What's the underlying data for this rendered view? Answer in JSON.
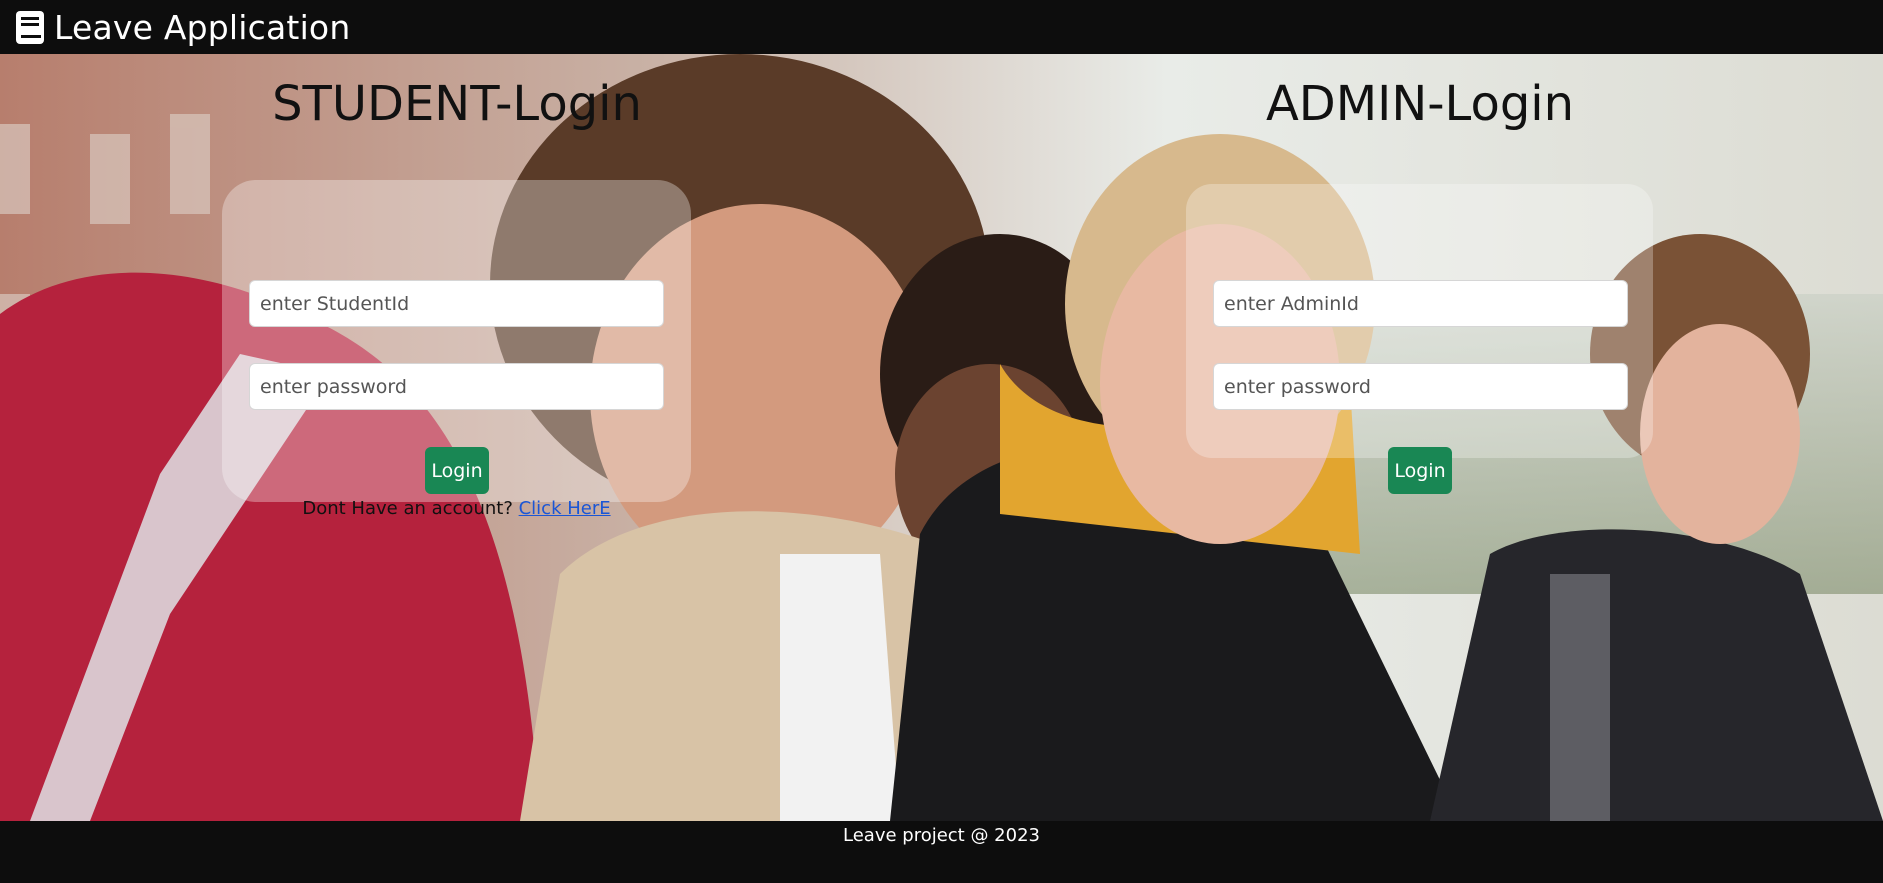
{
  "navbar": {
    "brand_icon": "book-icon",
    "brand_title": "Leave Application"
  },
  "hero": {
    "background": "photo of students looking down together"
  },
  "student_login": {
    "title": "STUDENT-Login",
    "id_placeholder": "enter StudentId",
    "password_placeholder": "enter password",
    "login_label": "Login",
    "signup_prompt": "Dont Have an account?",
    "signup_link": "Click HerE"
  },
  "admin_login": {
    "title": "ADMIN-Login",
    "id_placeholder": "enter AdminId",
    "password_placeholder": "enter password",
    "login_label": "Login"
  },
  "footer": {
    "text": "Leave project @ 2023"
  },
  "colors": {
    "navbar_bg": "#0d0d0d",
    "button_green": "#198754",
    "link_blue": "#1a56d6"
  }
}
